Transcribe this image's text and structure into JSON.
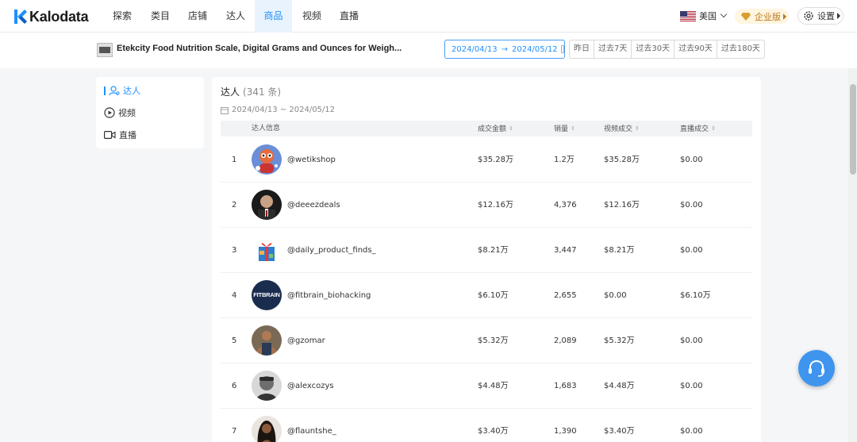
{
  "app": {
    "brand": "Kalodata",
    "brand_color": "#1e90ff"
  },
  "nav": {
    "items": [
      "探索",
      "类目",
      "店铺",
      "达人",
      "商品",
      "视频",
      "直播"
    ],
    "active": "商品"
  },
  "header_right": {
    "region": "美国",
    "enterprise_label": "企业版",
    "settings_label": "设置"
  },
  "product": {
    "title": "Etekcity Food Nutrition Scale, Digital Grams and Ounces for Weigh..."
  },
  "date_picker": {
    "start": "2024/04/13",
    "arrow": "→",
    "end": "2024/05/12"
  },
  "quick_ranges": [
    "昨日",
    "过去7天",
    "过去30天",
    "过去90天",
    "过去180天"
  ],
  "sidebar": {
    "items": [
      {
        "label": "达人",
        "icon": "creator-icon",
        "active": true
      },
      {
        "label": "视频",
        "icon": "play-circle-icon",
        "active": false
      },
      {
        "label": "直播",
        "icon": "video-camera-icon",
        "active": false
      }
    ]
  },
  "main": {
    "title": "达人",
    "count": "(341 条)",
    "date_range": "2024/04/13 ~ 2024/05/12",
    "columns": [
      "达人信息",
      "成交金额",
      "销量",
      "视频成交",
      "直播成交"
    ],
    "rows": [
      {
        "rank": "1",
        "handle": "@wetikshop",
        "gmv": "$35.28万",
        "sales": "1.2万",
        "video_gmv": "$35.28万",
        "live_gmv": "$0.00"
      },
      {
        "rank": "2",
        "handle": "@deeezdeals",
        "gmv": "$12.16万",
        "sales": "4,376",
        "video_gmv": "$12.16万",
        "live_gmv": "$0.00"
      },
      {
        "rank": "3",
        "handle": "@daily_product_finds_",
        "gmv": "$8.21万",
        "sales": "3,447",
        "video_gmv": "$8.21万",
        "live_gmv": "$0.00"
      },
      {
        "rank": "4",
        "handle": "@fitbrain_biohacking",
        "gmv": "$6.10万",
        "sales": "2,655",
        "video_gmv": "$0.00",
        "live_gmv": "$6.10万"
      },
      {
        "rank": "5",
        "handle": "@gzomar",
        "gmv": "$5.32万",
        "sales": "2,089",
        "video_gmv": "$5.32万",
        "live_gmv": "$0.00"
      },
      {
        "rank": "6",
        "handle": "@alexcozys",
        "gmv": "$4.48万",
        "sales": "1,683",
        "video_gmv": "$4.48万",
        "live_gmv": "$0.00"
      },
      {
        "rank": "7",
        "handle": "@flauntshe_",
        "gmv": "$3.40万",
        "sales": "1,390",
        "video_gmv": "$3.40万",
        "live_gmv": "$0.00"
      }
    ],
    "avatar_4_text": "FITBRAIN"
  }
}
